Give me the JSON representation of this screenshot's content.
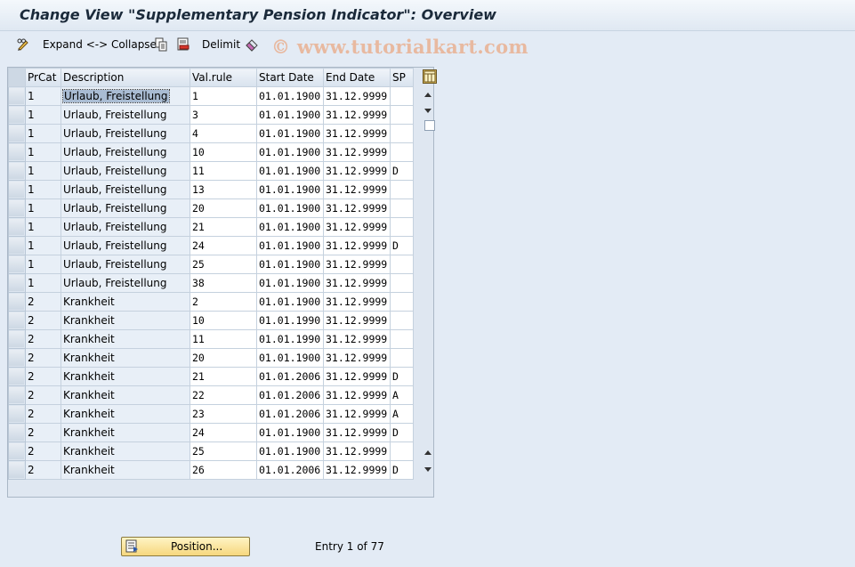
{
  "window": {
    "title": "Change View \"Supplementary Pension Indicator\": Overview"
  },
  "toolbar": {
    "expand_collapse_label": "Expand <-> Collapse",
    "delimit_label": "Delimit"
  },
  "watermark": "© www.tutorialkart.com",
  "table": {
    "columns": [
      "PrCat",
      "Description",
      "Val.rule",
      "Start Date",
      "End Date",
      "SP"
    ],
    "rows": [
      {
        "prcat": "1",
        "desc": "Urlaub, Freistellung",
        "valrule": "1",
        "start": "01.01.1900",
        "end": "31.12.9999",
        "sp": ""
      },
      {
        "prcat": "1",
        "desc": "Urlaub, Freistellung",
        "valrule": "3",
        "start": "01.01.1900",
        "end": "31.12.9999",
        "sp": ""
      },
      {
        "prcat": "1",
        "desc": "Urlaub, Freistellung",
        "valrule": "4",
        "start": "01.01.1900",
        "end": "31.12.9999",
        "sp": ""
      },
      {
        "prcat": "1",
        "desc": "Urlaub, Freistellung",
        "valrule": "10",
        "start": "01.01.1900",
        "end": "31.12.9999",
        "sp": ""
      },
      {
        "prcat": "1",
        "desc": "Urlaub, Freistellung",
        "valrule": "11",
        "start": "01.01.1900",
        "end": "31.12.9999",
        "sp": "D"
      },
      {
        "prcat": "1",
        "desc": "Urlaub, Freistellung",
        "valrule": "13",
        "start": "01.01.1900",
        "end": "31.12.9999",
        "sp": ""
      },
      {
        "prcat": "1",
        "desc": "Urlaub, Freistellung",
        "valrule": "20",
        "start": "01.01.1900",
        "end": "31.12.9999",
        "sp": ""
      },
      {
        "prcat": "1",
        "desc": "Urlaub, Freistellung",
        "valrule": "21",
        "start": "01.01.1900",
        "end": "31.12.9999",
        "sp": ""
      },
      {
        "prcat": "1",
        "desc": "Urlaub, Freistellung",
        "valrule": "24",
        "start": "01.01.1900",
        "end": "31.12.9999",
        "sp": "D"
      },
      {
        "prcat": "1",
        "desc": "Urlaub, Freistellung",
        "valrule": "25",
        "start": "01.01.1900",
        "end": "31.12.9999",
        "sp": ""
      },
      {
        "prcat": "1",
        "desc": "Urlaub, Freistellung",
        "valrule": "38",
        "start": "01.01.1900",
        "end": "31.12.9999",
        "sp": ""
      },
      {
        "prcat": "2",
        "desc": "Krankheit",
        "valrule": "2",
        "start": "01.01.1900",
        "end": "31.12.9999",
        "sp": ""
      },
      {
        "prcat": "2",
        "desc": "Krankheit",
        "valrule": "10",
        "start": "01.01.1990",
        "end": "31.12.9999",
        "sp": ""
      },
      {
        "prcat": "2",
        "desc": "Krankheit",
        "valrule": "11",
        "start": "01.01.1990",
        "end": "31.12.9999",
        "sp": ""
      },
      {
        "prcat": "2",
        "desc": "Krankheit",
        "valrule": "20",
        "start": "01.01.1900",
        "end": "31.12.9999",
        "sp": ""
      },
      {
        "prcat": "2",
        "desc": "Krankheit",
        "valrule": "21",
        "start": "01.01.2006",
        "end": "31.12.9999",
        "sp": "D"
      },
      {
        "prcat": "2",
        "desc": "Krankheit",
        "valrule": "22",
        "start": "01.01.2006",
        "end": "31.12.9999",
        "sp": "A"
      },
      {
        "prcat": "2",
        "desc": "Krankheit",
        "valrule": "23",
        "start": "01.01.2006",
        "end": "31.12.9999",
        "sp": "A"
      },
      {
        "prcat": "2",
        "desc": "Krankheit",
        "valrule": "24",
        "start": "01.01.1900",
        "end": "31.12.9999",
        "sp": "D"
      },
      {
        "prcat": "2",
        "desc": "Krankheit",
        "valrule": "25",
        "start": "01.01.1900",
        "end": "31.12.9999",
        "sp": ""
      },
      {
        "prcat": "2",
        "desc": "Krankheit",
        "valrule": "26",
        "start": "01.01.2006",
        "end": "31.12.9999",
        "sp": "D"
      }
    ]
  },
  "footer": {
    "position_button_label": "Position...",
    "entry_text": "Entry 1 of 77"
  },
  "colors": {
    "background": "#e3ebf5",
    "button_fill": "#f6d77e",
    "watermark": "#e8b9a0"
  }
}
